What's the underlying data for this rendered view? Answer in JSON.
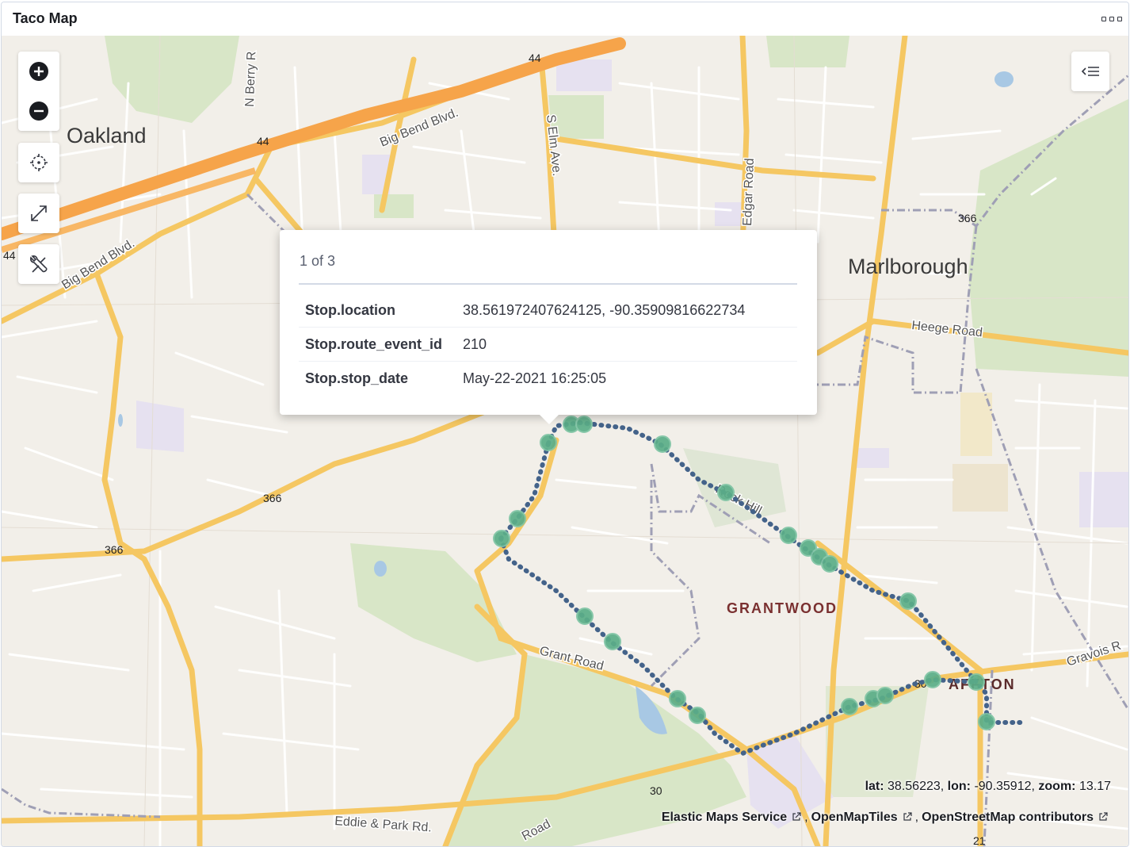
{
  "panel": {
    "title": "Taco Map"
  },
  "map": {
    "places": {
      "oakland": "Oakland",
      "marlborough": "Marlborough",
      "grantwood": "GRANTWOOD",
      "affton": "AFFTON"
    },
    "roads": {
      "big_bend_1": "Big Bend Blvd.",
      "big_bend_2": "Big Bend Blvd.",
      "n_berry": "N Berry R",
      "s_elm": "S Elm Ave.",
      "edgar": "Edgar Road",
      "heege": "Heege Road",
      "grant": "Grant Road",
      "gravois": "Gravois R",
      "eddie_park": "Eddie & Park Rd.",
      "rock_hill": "Rock Hill",
      "road_bottom": "Road"
    },
    "shields": {
      "i44_a": "44",
      "i44_b": "44",
      "i44_c": "44",
      "r366_a": "366",
      "r366_b": "366",
      "r366_c": "366",
      "r30_a": "30",
      "r30_b": "30",
      "r21": "21"
    }
  },
  "tooltip": {
    "pager": "1 of 3",
    "rows": [
      {
        "key": "Stop.location",
        "value": "38.561972407624125, -90.35909816622734"
      },
      {
        "key": "Stop.route_event_id",
        "value": "210"
      },
      {
        "key": "Stop.stop_date",
        "value": "May-22-2021 16:25:05"
      }
    ]
  },
  "status": {
    "lat_label": "lat:",
    "lat": "38.56223",
    "lon_label": "lon:",
    "lon": "-90.35912",
    "zoom_label": "zoom:",
    "zoom": "13.17"
  },
  "attribution": {
    "ems": "Elastic Maps Service",
    "omt": "OpenMapTiles",
    "osm": "OpenStreetMap contributors"
  },
  "icons": [
    "zoom-in-icon",
    "zoom-out-icon",
    "crosshair-icon",
    "fullscreen-icon",
    "tools-icon",
    "layer-panel-icon",
    "external-link-icon"
  ],
  "colors": {
    "land": "#f2efe9",
    "park": "#d8e6c7",
    "water": "#a8c8e4",
    "highway": "#f6a44a",
    "road": "#f9d37a",
    "minor_road": "#ffffff",
    "route_line": "#44638a",
    "stop_point": "#5bae88"
  }
}
